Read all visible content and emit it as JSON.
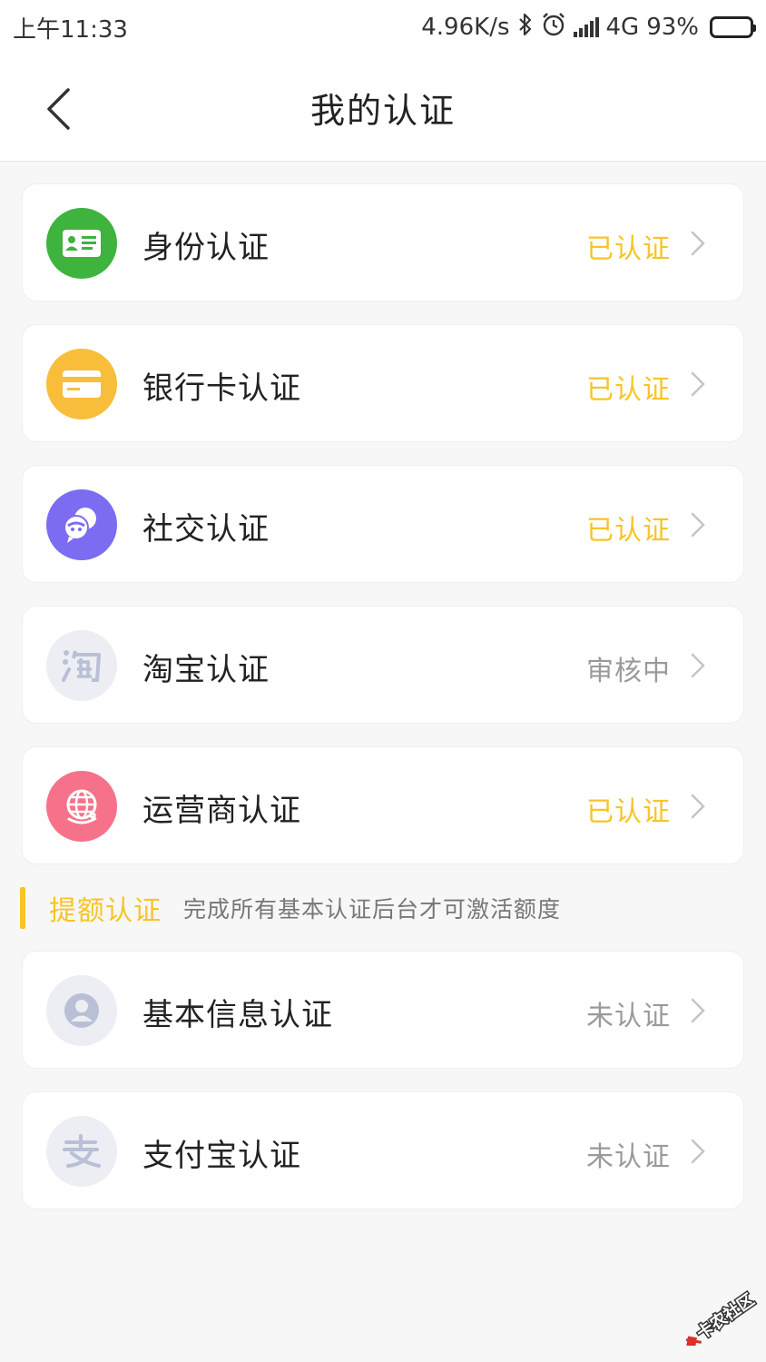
{
  "status_bar": {
    "time": "上午11:33",
    "speed": "4.96K/s",
    "network": "4G",
    "battery": "93%",
    "icons": [
      "bluetooth-icon",
      "alarm-icon",
      "signal-icon",
      "battery-icon"
    ]
  },
  "nav": {
    "title": "我的认证",
    "back_icon": "chevron-left-icon"
  },
  "basic_items": [
    {
      "label": "身份认证",
      "status": "已认证",
      "icon": "id-card-icon",
      "color": "#3eb33e"
    },
    {
      "label": "银行卡认证",
      "status": "已认证",
      "icon": "bank-card-icon",
      "color": "#f8bd3a"
    },
    {
      "label": "社交认证",
      "status": "已认证",
      "icon": "social-chat-icon",
      "color": "#7b6cf2"
    },
    {
      "label": "淘宝认证",
      "status": "审核中",
      "icon": "taobao-icon",
      "color": "#eceef3"
    },
    {
      "label": "运营商认证",
      "status": "已认证",
      "icon": "carrier-globe-icon",
      "color": "#f5728a"
    }
  ],
  "section": {
    "title": "提额认证",
    "description": "完成所有基本认证后台才可激活额度"
  },
  "extra_items": [
    {
      "label": "基本信息认证",
      "status": "未认证",
      "icon": "user-profile-icon",
      "color": "#eceef3"
    },
    {
      "label": "支付宝认证",
      "status": "未认证",
      "icon": "alipay-icon",
      "color": "#eceef3"
    }
  ],
  "watermark": {
    "text": "卡农社区"
  },
  "colors": {
    "accent": "#f7c427",
    "muted_status": "#9a9a9a"
  }
}
